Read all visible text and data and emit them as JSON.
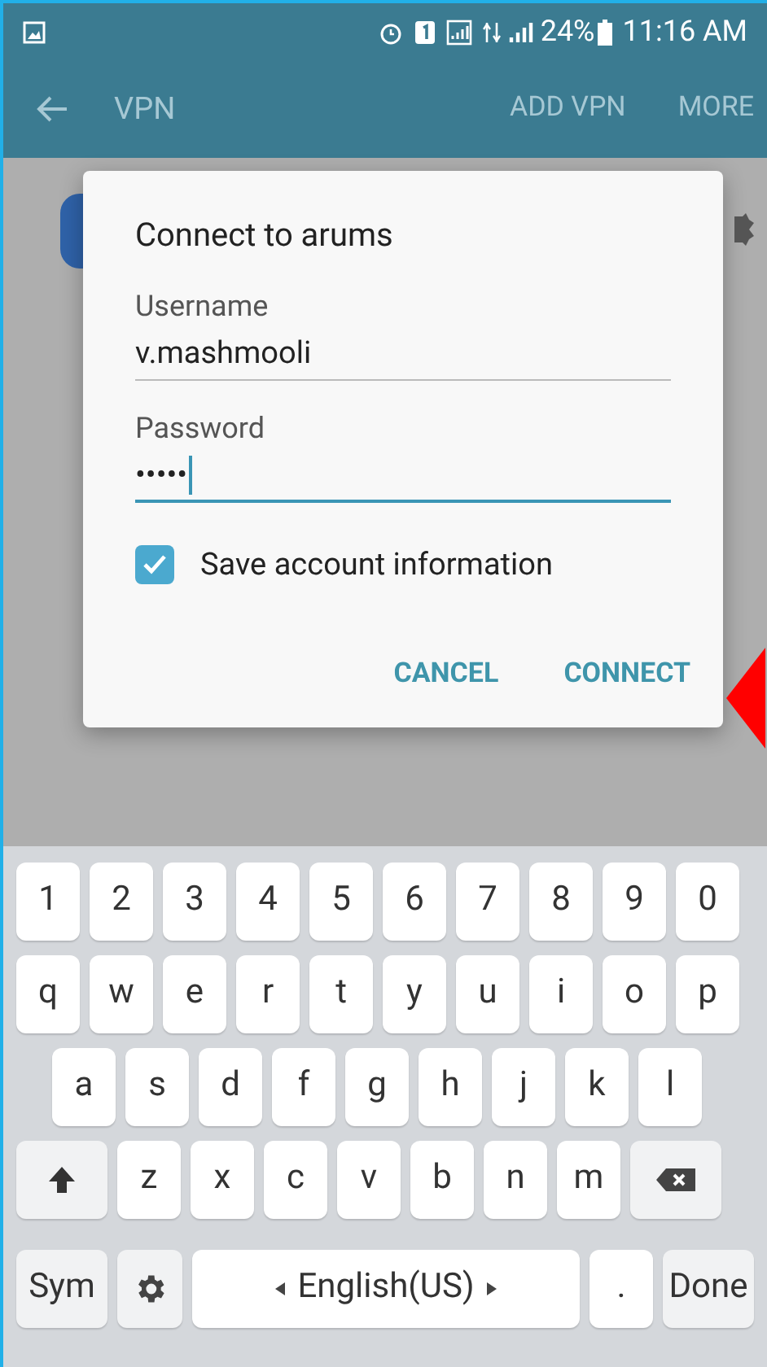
{
  "status_bar": {
    "battery": "24%",
    "time": "11:16 AM"
  },
  "app_bar": {
    "title": "VPN",
    "actions": [
      "ADD VPN",
      "MORE"
    ]
  },
  "dialog": {
    "title": "Connect to arums",
    "fields": [
      {
        "label": "Username",
        "value": "v.mashmooli",
        "focused": false
      },
      {
        "label": "Password",
        "value": "•••••",
        "focused": true
      }
    ],
    "checkbox": {
      "label": "Save account information",
      "checked": true
    },
    "buttons": [
      "CANCEL",
      "CONNECT"
    ]
  },
  "keyboard": {
    "rows": [
      {
        "keys": [
          {
            "kind": "char",
            "label": "1"
          },
          {
            "kind": "char",
            "label": "2"
          },
          {
            "kind": "char",
            "label": "3"
          },
          {
            "kind": "char",
            "label": "4"
          },
          {
            "kind": "char",
            "label": "5"
          },
          {
            "kind": "char",
            "label": "6"
          },
          {
            "kind": "char",
            "label": "7"
          },
          {
            "kind": "char",
            "label": "8"
          },
          {
            "kind": "char",
            "label": "9"
          },
          {
            "kind": "char",
            "label": "0"
          }
        ]
      },
      {
        "keys": [
          {
            "kind": "char",
            "label": "q"
          },
          {
            "kind": "char",
            "label": "w"
          },
          {
            "kind": "char",
            "label": "e"
          },
          {
            "kind": "char",
            "label": "r"
          },
          {
            "kind": "char",
            "label": "t"
          },
          {
            "kind": "char",
            "label": "y"
          },
          {
            "kind": "char",
            "label": "u"
          },
          {
            "kind": "char",
            "label": "i"
          },
          {
            "kind": "char",
            "label": "o"
          },
          {
            "kind": "char",
            "label": "p"
          }
        ]
      },
      {
        "keys": [
          {
            "kind": "char",
            "label": "a"
          },
          {
            "kind": "char",
            "label": "s"
          },
          {
            "kind": "char",
            "label": "d"
          },
          {
            "kind": "char",
            "label": "f"
          },
          {
            "kind": "char",
            "label": "g"
          },
          {
            "kind": "char",
            "label": "h"
          },
          {
            "kind": "char",
            "label": "j"
          },
          {
            "kind": "char",
            "label": "k"
          },
          {
            "kind": "char",
            "label": "l"
          }
        ]
      },
      {
        "keys": [
          {
            "kind": "shift"
          },
          {
            "kind": "char",
            "label": "z"
          },
          {
            "kind": "char",
            "label": "x"
          },
          {
            "kind": "char",
            "label": "c"
          },
          {
            "kind": "char",
            "label": "v"
          },
          {
            "kind": "char",
            "label": "b"
          },
          {
            "kind": "char",
            "label": "n"
          },
          {
            "kind": "char",
            "label": "m"
          },
          {
            "kind": "backspace"
          }
        ]
      },
      {
        "keys": [
          {
            "kind": "func",
            "label": "Sym"
          },
          {
            "kind": "settings"
          },
          {
            "kind": "space",
            "label": "English(US)"
          },
          {
            "kind": "char",
            "label": "."
          },
          {
            "kind": "func",
            "label": "Done"
          }
        ]
      }
    ]
  }
}
